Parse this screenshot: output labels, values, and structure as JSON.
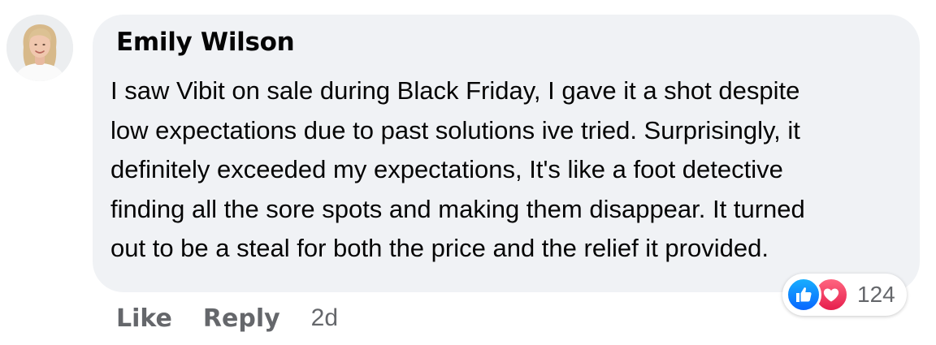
{
  "comment": {
    "author": "Emily Wilson",
    "avatar_icon": "profile-photo",
    "text": "I saw Vibit on sale during Black Friday, I gave it a shot despite\nlow expectations due to past solutions ive tried. Surprisingly, it\ndefinitely exceeded my expectations, It's like a foot detective\nfinding all the sore spots and making them disappear.  It turned\nout to be a steal for both the price and the relief it provided.",
    "reactions": {
      "icons": [
        "like-icon",
        "love-icon"
      ],
      "count": "124"
    },
    "actions": {
      "like": "Like",
      "reply": "Reply"
    },
    "timestamp": "2d"
  },
  "colors": {
    "bubble": "#f0f2f5",
    "text": "#050505",
    "secondary": "#65676b",
    "like_blue": "#0866ff",
    "love_red": "#e61e4d"
  }
}
